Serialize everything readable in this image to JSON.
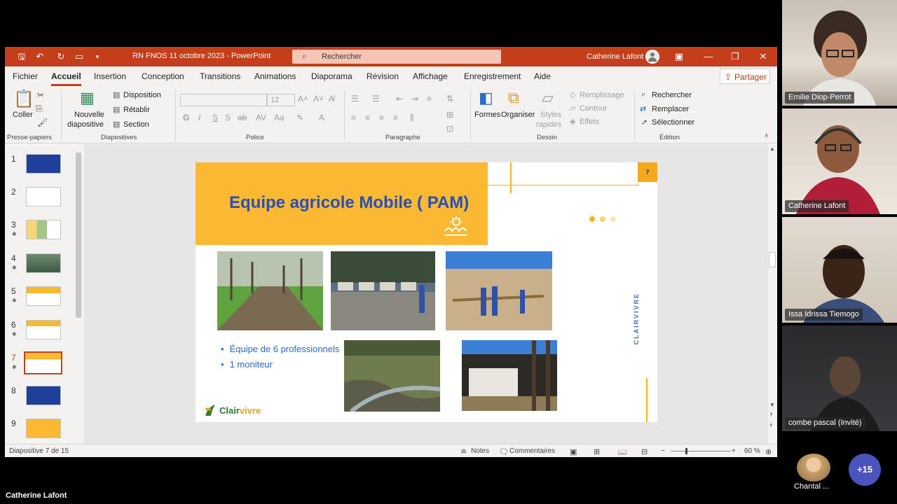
{
  "window": {
    "document_title": "RN FNOS 11 octobre 2023  -  PowerPoint",
    "search_placeholder": "Rechercher",
    "user_name": "Catherine Lafont"
  },
  "menu": {
    "tabs": [
      "Fichier",
      "Accueil",
      "Insertion",
      "Conception",
      "Transitions",
      "Animations",
      "Diaporama",
      "Révision",
      "Affichage",
      "Enregistrement",
      "Aide"
    ],
    "active_tab": "Accueil",
    "share_label": "Partager"
  },
  "ribbon": {
    "clipboard": {
      "paste": "Coller",
      "group": "Presse-papiers"
    },
    "slides": {
      "new_slide_line1": "Nouvelle",
      "new_slide_line2": "diapositive",
      "layout": "Disposition",
      "reset": "Rétablir",
      "section": "Section",
      "group": "Diapositives"
    },
    "font": {
      "size": "12",
      "group": "Police"
    },
    "paragraph": {
      "group": "Paragraphe"
    },
    "drawing": {
      "shapes": "Formes",
      "arrange": "Organiser",
      "quick_styles_line1": "Styles",
      "quick_styles_line2": "rapides",
      "fill": "Remplissage",
      "outline": "Contour",
      "effects": "Effets",
      "group": "Dessin"
    },
    "editing": {
      "find": "Rechercher",
      "replace": "Remplacer",
      "select": "Sélectionner",
      "group": "Édition"
    }
  },
  "thumbnails": [
    {
      "num": "1",
      "star": false,
      "theme": "blue"
    },
    {
      "num": "2",
      "star": false,
      "theme": "white"
    },
    {
      "num": "3",
      "star": true,
      "theme": "map"
    },
    {
      "num": "4",
      "star": true,
      "theme": "photo"
    },
    {
      "num": "5",
      "star": true,
      "theme": "yellow"
    },
    {
      "num": "6",
      "star": true,
      "theme": "yellow"
    },
    {
      "num": "7",
      "star": true,
      "theme": "yellow",
      "selected": true
    },
    {
      "num": "8",
      "star": false,
      "theme": "blue"
    },
    {
      "num": "9",
      "star": false,
      "theme": "yellow"
    }
  ],
  "slide": {
    "title": "Equipe agricole Mobile ( PAM)",
    "number": "7",
    "brand_vertical": "CLAIRVIVRE",
    "bullets": [
      "Équipe de 6 professionnels",
      "1 moniteur"
    ],
    "logo_main": "Clair",
    "logo_accent": "vivre",
    "accent_color": "#fbb832",
    "title_color": "#2a50b8"
  },
  "status": {
    "slide_counter": "Diapositive 7 de 15",
    "notes": "Notes",
    "comments": "Commentaires",
    "zoom": "60 %"
  },
  "participants": [
    {
      "name": "Emilie Diop-Perrot"
    },
    {
      "name": "Catherine Lafont"
    },
    {
      "name": "Issa Idrissa Tiemogo"
    },
    {
      "name": "combe pascal (Invité)"
    }
  ],
  "self_label": "Catherine Lafont",
  "extra_participant": "Chantal ...",
  "more_count": "+15"
}
